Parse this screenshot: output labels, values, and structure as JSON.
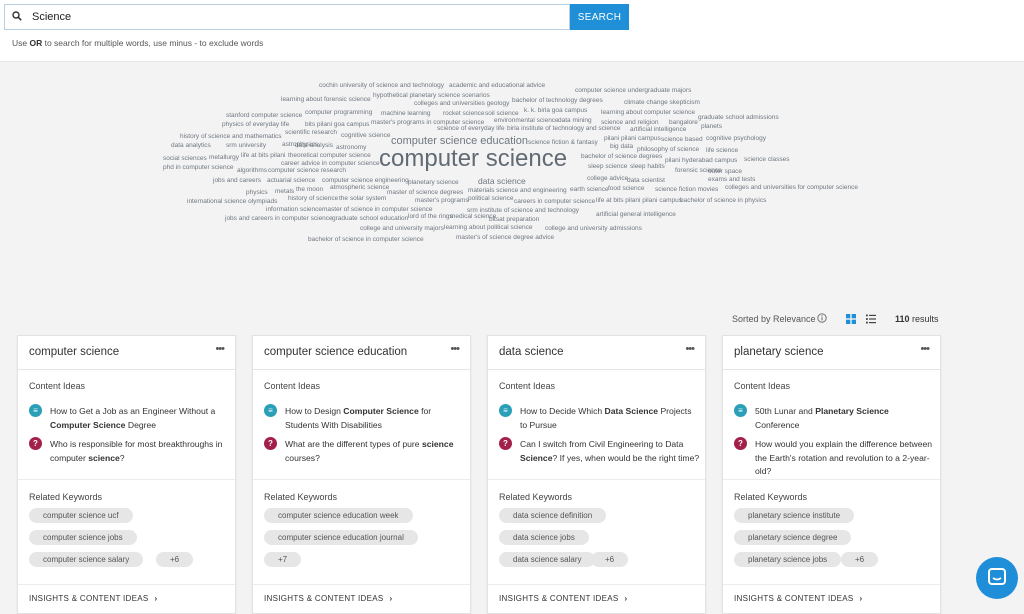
{
  "search": {
    "value": "Science",
    "button_label": "SEARCH",
    "hint_prefix": "Use ",
    "hint_bold": "OR",
    "hint_suffix": " to search for multiple words, use minus - to exclude words"
  },
  "cloud": [
    {
      "t": "cochin university of science and technology"
    },
    {
      "t": "academic and educational advice"
    },
    {
      "t": "computer science undergraduate majors"
    },
    {
      "t": "hypothetical planetary science scenarios"
    },
    {
      "t": "learning about forensic science"
    },
    {
      "t": "bachelor of technology degrees"
    },
    {
      "t": "colleges and universities geology"
    },
    {
      "t": "climate change skepticism"
    },
    {
      "t": "computer programming"
    },
    {
      "t": "machine learning"
    },
    {
      "t": "rocket science"
    },
    {
      "t": "soil science"
    },
    {
      "t": "k. k. birla goa campus"
    },
    {
      "t": "learning about computer science"
    },
    {
      "t": "stanford computer science"
    },
    {
      "t": "graduate school admissions"
    },
    {
      "t": "physics of everyday life"
    },
    {
      "t": "bits pilani goa campus"
    },
    {
      "t": "master's programs in computer science"
    },
    {
      "t": "environmental science"
    },
    {
      "t": "data mining"
    },
    {
      "t": "science and religion"
    },
    {
      "t": "bangalore"
    },
    {
      "t": "planets"
    },
    {
      "t": "scientific research"
    },
    {
      "t": "science of everyday life"
    },
    {
      "t": "birla institute of technology and science"
    },
    {
      "t": "artificial intelligence"
    },
    {
      "t": "history of science and mathematics"
    },
    {
      "t": "cognitive science"
    },
    {
      "t": "computer science education"
    },
    {
      "t": "pilani pilani campus"
    },
    {
      "t": "science based"
    },
    {
      "t": "cognitive psychology"
    },
    {
      "t": "data analytics"
    },
    {
      "t": "srm university"
    },
    {
      "t": "astrophysics"
    },
    {
      "t": "data analysis"
    },
    {
      "t": "astronomy"
    },
    {
      "t": "science fiction & fantasy"
    },
    {
      "t": "big data"
    },
    {
      "t": "philosophy of science"
    },
    {
      "t": "life science"
    },
    {
      "t": "social sciences"
    },
    {
      "t": "metallurgy"
    },
    {
      "t": "life at bits pilani"
    },
    {
      "t": "theoretical computer science"
    },
    {
      "t": "computer science"
    },
    {
      "t": "bachelor of science degrees"
    },
    {
      "t": "pilani hyderabad campus"
    },
    {
      "t": "science classes"
    },
    {
      "t": "phd in computer science"
    },
    {
      "t": "career advice in computer science"
    },
    {
      "t": "sleep science"
    },
    {
      "t": "sleep habits"
    },
    {
      "t": "algorithms"
    },
    {
      "t": "computer science research"
    },
    {
      "t": "forensic science"
    },
    {
      "t": "outer space"
    },
    {
      "t": "jobs and careers"
    },
    {
      "t": "actuarial science"
    },
    {
      "t": "computer science engineering"
    },
    {
      "t": "planetary science"
    },
    {
      "t": "data science"
    },
    {
      "t": "college advice"
    },
    {
      "t": "data scientist"
    },
    {
      "t": "exams and tests"
    },
    {
      "t": "physics"
    },
    {
      "t": "metals"
    },
    {
      "t": "the moon"
    },
    {
      "t": "atmospheric science"
    },
    {
      "t": "materials science and engineering"
    },
    {
      "t": "earth science"
    },
    {
      "t": "food science"
    },
    {
      "t": "science fiction movies"
    },
    {
      "t": "colleges and universities for computer science"
    },
    {
      "t": "master of science degrees"
    },
    {
      "t": "international science olympiads"
    },
    {
      "t": "history of science"
    },
    {
      "t": "the solar system"
    },
    {
      "t": "political science"
    },
    {
      "t": "master's programs"
    },
    {
      "t": "careers in computer science"
    },
    {
      "t": "life at bits pilani pilani campus"
    },
    {
      "t": "bachelor of science in physics"
    },
    {
      "t": "information science"
    },
    {
      "t": "master of science in computer science"
    },
    {
      "t": "srm institute of science and technology"
    },
    {
      "t": "jobs and careers in computer science"
    },
    {
      "t": "graduate school education"
    },
    {
      "t": "lord of the rings"
    },
    {
      "t": "medical science"
    },
    {
      "t": "bitsat preparation"
    },
    {
      "t": "artificial general intelligence"
    },
    {
      "t": "college and university majors"
    },
    {
      "t": "learning about political science"
    },
    {
      "t": "college and university admissions"
    },
    {
      "t": "bachelor of science in computer science"
    },
    {
      "t": "master's of science degree advice"
    }
  ],
  "sort": {
    "label": "Sorted by Relevance",
    "count": "110",
    "count_suffix": " results"
  },
  "cards": [
    {
      "title": "computer science",
      "menu": "•••",
      "content_ideas_label": "Content Ideas",
      "ideas": [
        {
          "type": "doc",
          "pre": "How to Get a Job as an Engineer Without a ",
          "bold": "Computer Science",
          "post": " Degree"
        },
        {
          "type": "q",
          "pre": "Who is responsible for most breakthroughs in computer ",
          "bold": "science",
          "post": "?"
        }
      ],
      "related_label": "Related Keywords",
      "keywords": [
        "computer science ucf",
        "computer science jobs",
        "computer science salary",
        "+6"
      ],
      "footer": "INSIGHTS & CONTENT IDEAS"
    },
    {
      "title": "computer science education",
      "menu": "•••",
      "content_ideas_label": "Content Ideas",
      "ideas": [
        {
          "type": "doc",
          "pre": "How to Design ",
          "bold": "Computer Science",
          "post": " for Students With Disabilities"
        },
        {
          "type": "q",
          "pre": "What are the different types of pure ",
          "bold": "science",
          "post": " courses?"
        }
      ],
      "related_label": "Related Keywords",
      "keywords": [
        "computer science education week",
        "computer science education journal",
        "+7"
      ],
      "footer": "INSIGHTS & CONTENT IDEAS"
    },
    {
      "title": "data science",
      "menu": "•••",
      "content_ideas_label": "Content Ideas",
      "ideas": [
        {
          "type": "doc",
          "pre": "How to Decide Which ",
          "bold": "Data Science",
          "post": " Projects to Pursue"
        },
        {
          "type": "q",
          "pre": "Can I switch from Civil Engineering to Data ",
          "bold": "Science",
          "post": "? If yes, when would be the right time?"
        }
      ],
      "related_label": "Related Keywords",
      "keywords": [
        "data science definition",
        "data science jobs",
        "data science salary",
        "+6"
      ],
      "footer": "INSIGHTS & CONTENT IDEAS"
    },
    {
      "title": "planetary science",
      "menu": "•••",
      "content_ideas_label": "Content Ideas",
      "ideas": [
        {
          "type": "doc",
          "pre": "50th Lunar and ",
          "bold": "Planetary Science",
          "post": " Conference"
        },
        {
          "type": "q",
          "pre": "How would you explain the difference between the Earth's rotation and revolution to a 2-year-old?",
          "bold": "",
          "post": ""
        }
      ],
      "related_label": "Related Keywords",
      "keywords": [
        "planetary science institute",
        "planetary science degree",
        "planetary science jobs",
        "+6"
      ],
      "footer": "INSIGHTS & CONTENT IDEAS"
    }
  ],
  "colors": {
    "accent": "#1f8fd7",
    "doc_icon": "#2aa0b8",
    "question_icon": "#a3204a",
    "chat": "#1e8ed9"
  }
}
